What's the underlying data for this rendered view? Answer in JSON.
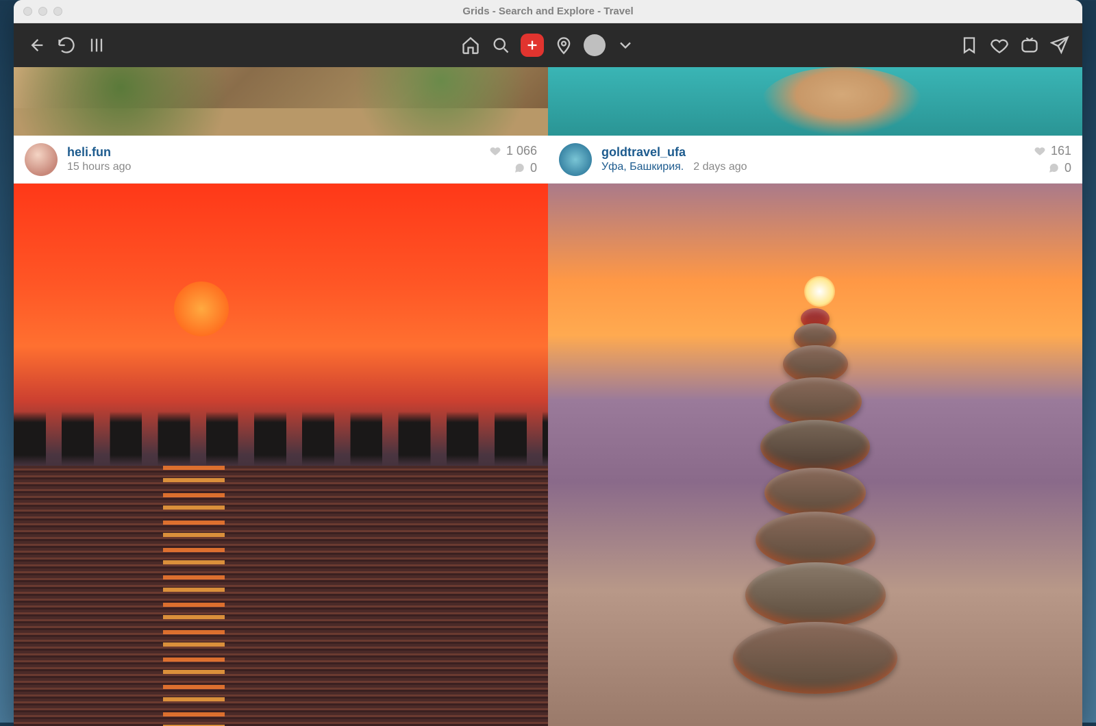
{
  "window": {
    "title": "Grids - Search and Explore - Travel"
  },
  "toolbar": {
    "left": {
      "back": "back-icon",
      "reload": "reload-icon",
      "columns": "columns-icon"
    },
    "center": {
      "home": "home-icon",
      "search": "search-icon",
      "add": "plus-icon",
      "location": "location-pin-icon",
      "profile": "profile-avatar",
      "dropdown": "chevron-down-icon"
    },
    "right": {
      "bookmark": "bookmark-icon",
      "likes": "heart-icon",
      "igtv": "igtv-icon",
      "send": "send-icon"
    }
  },
  "posts": [
    {
      "username": "heli.fun",
      "location": "",
      "time": "15 hours ago",
      "likes": "1 066",
      "comments": "0"
    },
    {
      "username": "goldtravel_ufa",
      "location": "Уфа, Башкирия.",
      "time": "2 days ago",
      "likes": "161",
      "comments": "0"
    }
  ]
}
